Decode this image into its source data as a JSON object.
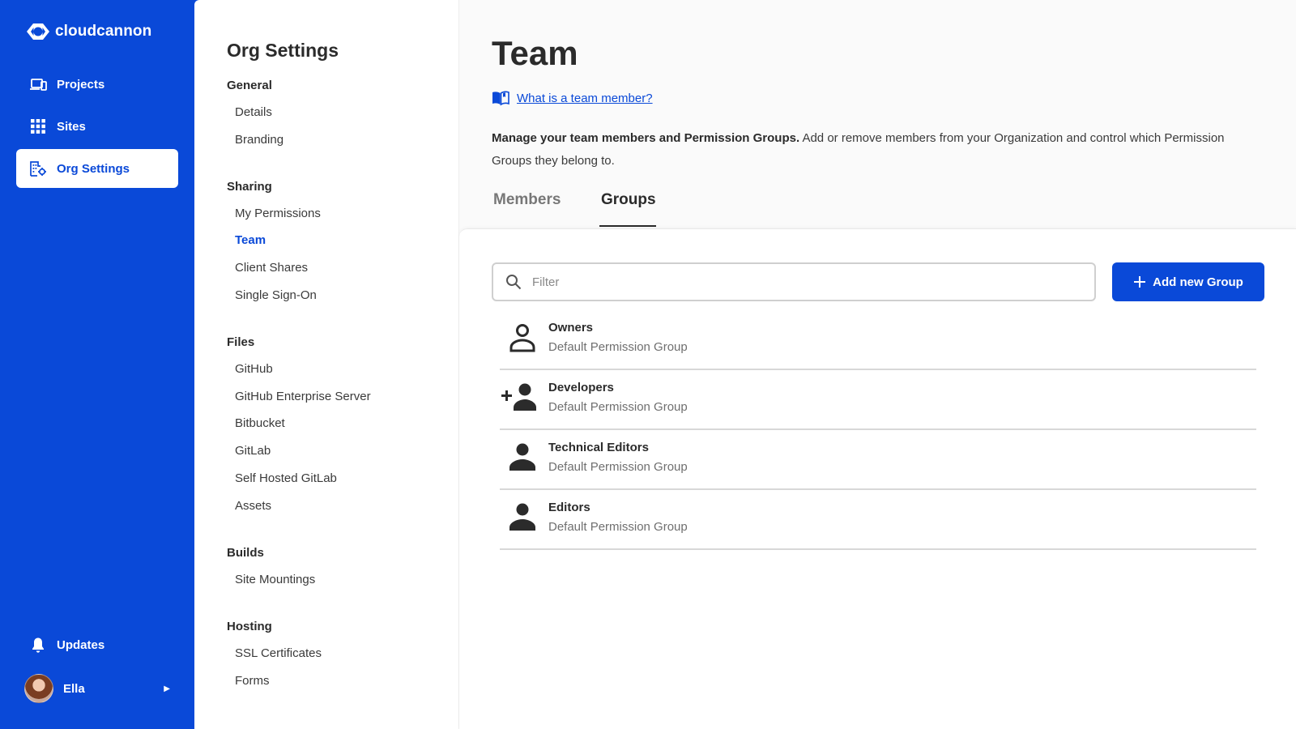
{
  "brand": {
    "name": "cloudcannon",
    "accent": "#0a49d8"
  },
  "nav": {
    "items": [
      {
        "label": "Projects",
        "icon": "devices-icon"
      },
      {
        "label": "Sites",
        "icon": "grid-icon"
      },
      {
        "label": "Org Settings",
        "icon": "org-settings-icon",
        "active": true
      }
    ],
    "updates_label": "Updates",
    "user_name": "Ella"
  },
  "subnav": {
    "title": "Org Settings",
    "sections": [
      {
        "heading": "General",
        "links": [
          "Details",
          "Branding"
        ]
      },
      {
        "heading": "Sharing",
        "links": [
          "My Permissions",
          "Team",
          "Client Shares",
          "Single Sign-On"
        ],
        "current": "Team"
      },
      {
        "heading": "Files",
        "links": [
          "GitHub",
          "GitHub Enterprise Server",
          "Bitbucket",
          "GitLab",
          "Self Hosted GitLab",
          "Assets"
        ]
      },
      {
        "heading": "Builds",
        "links": [
          "Site Mountings"
        ]
      },
      {
        "heading": "Hosting",
        "links": [
          "SSL Certificates",
          "Forms"
        ]
      }
    ]
  },
  "main": {
    "title": "Team",
    "help_link": "What is a team member?",
    "intro_bold": "Manage your team members and Permission Groups.",
    "intro_rest": " Add or remove members from your Organization and control which Permission Groups they belong to.",
    "tabs": [
      {
        "label": "Members",
        "active": false
      },
      {
        "label": "Groups",
        "active": true
      }
    ],
    "filter_placeholder": "Filter",
    "add_button_label": "Add new Group",
    "groups": [
      {
        "name": "Owners",
        "description": "Default Permission Group",
        "icon": "person-outline-icon"
      },
      {
        "name": "Developers",
        "description": "Default Permission Group",
        "icon": "person-add-icon"
      },
      {
        "name": "Technical Editors",
        "description": "Default Permission Group",
        "icon": "person-icon"
      },
      {
        "name": "Editors",
        "description": "Default Permission Group",
        "icon": "person-icon"
      }
    ]
  }
}
